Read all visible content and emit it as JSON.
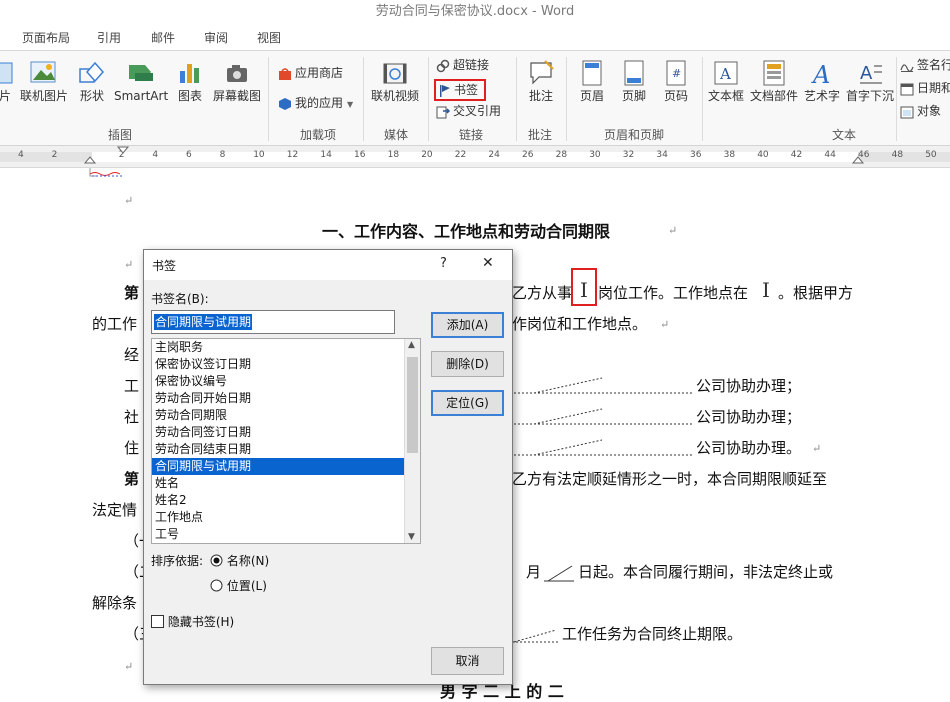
{
  "window": {
    "title": "劳动合同与保密协议.docx - Word"
  },
  "tabs": [
    "页面布局",
    "引用",
    "邮件",
    "审阅",
    "视图"
  ],
  "ribbon": {
    "groups": [
      {
        "label": "插图"
      },
      {
        "label": "加载项"
      },
      {
        "label": "媒体"
      },
      {
        "label": "链接"
      },
      {
        "label": "批注"
      },
      {
        "label": "页眉和页脚"
      },
      {
        "label": "文本"
      }
    ],
    "buttons": {
      "pic_cut": "片",
      "online_pic": "联机图片",
      "shapes": "形状",
      "smartart": "SmartArt",
      "chart": "图表",
      "screenshot": "屏幕截图",
      "store": "应用商店",
      "my_apps": "我的应用",
      "online_video": "联机视频",
      "hyperlink": "超链接",
      "bookmark": "书签",
      "cross_ref": "交叉引用",
      "comment": "批注",
      "header": "页眉",
      "footer": "页脚",
      "page_num": "页码",
      "textbox": "文本框",
      "doc_parts": "文档部件",
      "wordart": "艺术字",
      "dropcap": "首字下沉",
      "signature": "签名行",
      "datetime": "日期和",
      "object": "对象"
    }
  },
  "ruler": {
    "labels": [
      "4",
      "2",
      "",
      "2",
      "4",
      "6",
      "8",
      "10",
      "12",
      "14",
      "16",
      "18",
      "20",
      "22",
      "24",
      "26",
      "28",
      "30",
      "32",
      "34",
      "36",
      "38",
      "40",
      "42",
      "44",
      "46",
      "48",
      "50"
    ]
  },
  "document": {
    "heading": "一、工作内容、工作地点和劳动合同期限",
    "p1_bold": "第",
    "p1_right": "乙方从事",
    "p1_right2": "岗位工作。工作地点在",
    "p1_right3": "。根据甲方",
    "p2_left": "的工作",
    "p2_right": "作岗位和工作地点。",
    "p3_left": "经",
    "p4_left": "工",
    "p4_right": "公司协助办理；",
    "p5_left": "社",
    "p5_right": "公司协助办理；",
    "p6_left": "住",
    "p6_right": "公司协助办理。",
    "p7_bold": "第",
    "p7_right": "乙方有法定顺延情形之一时，本合同期限顺延至",
    "p8_left": "法定情",
    "p9_left": "（一",
    "p10_left": "（二",
    "p10_right": "月",
    "p10_right2": "日起。本合同履行期间，非法定终止或",
    "p11_left": "解除条",
    "p12_left": "（三",
    "p12_right": "工作任务为合同终止期限。",
    "bottom_partial": "男 字 二 上 的 二"
  },
  "dialog": {
    "title": "书签",
    "help": "?",
    "close": "✕",
    "name_label": "书签名(B):",
    "name_value": "合同期限与试用期",
    "items": [
      "主岗职务",
      "保密协议签订日期",
      "保密协议编号",
      "劳动合同开始日期",
      "劳动合同期限",
      "劳动合同签订日期",
      "劳动合同结束日期",
      "合同期限与试用期",
      "姓名",
      "姓名2",
      "工作地点",
      "工号"
    ],
    "selected_index": 7,
    "sort_label": "排序依据:",
    "sort_name": "名称(N)",
    "sort_position": "位置(L)",
    "sort_selected": "name",
    "hidden_label": "隐藏书签(H)",
    "hidden_checked": false,
    "add": "添加(A)",
    "delete": "删除(D)",
    "goto": "定位(G)",
    "cancel": "取消"
  },
  "colors": {
    "accent": "#2b579a",
    "highlight_red": "#e02020",
    "selection": "#0a64d0"
  }
}
